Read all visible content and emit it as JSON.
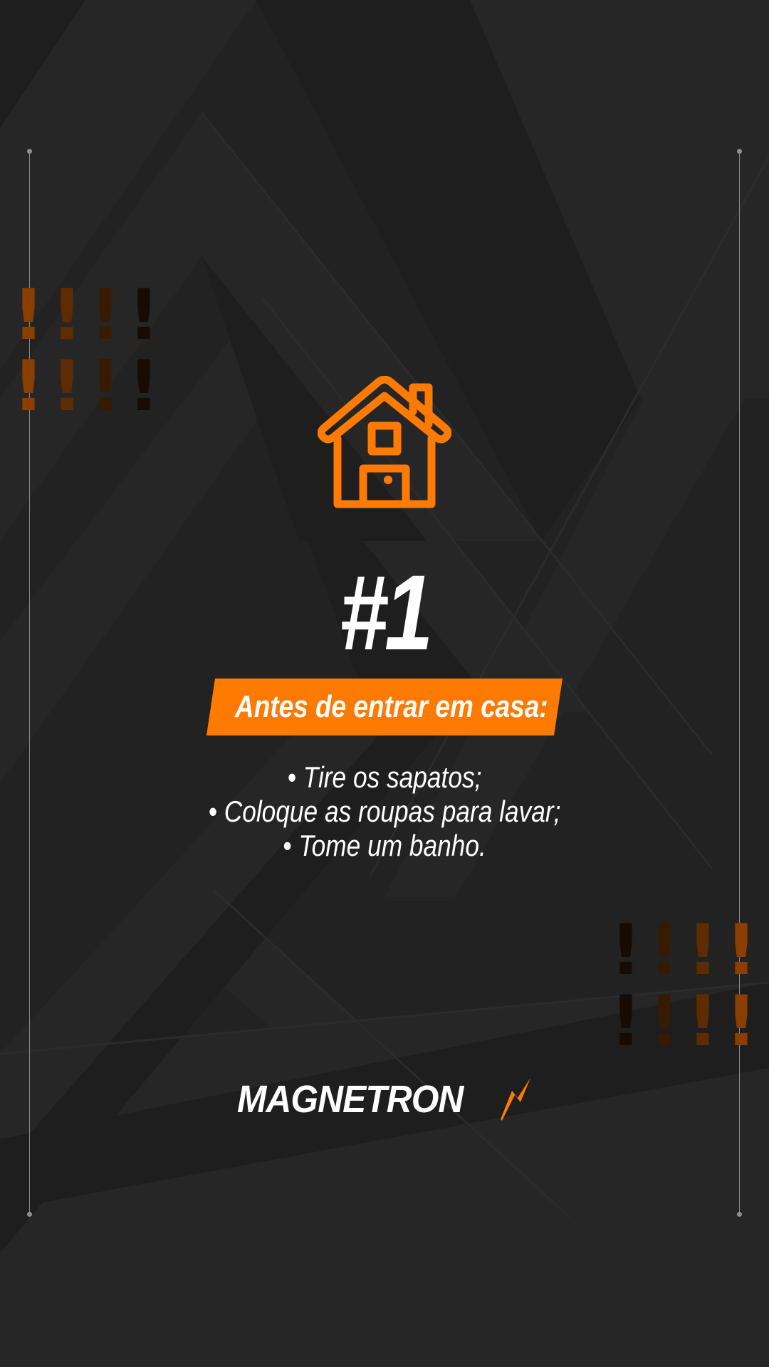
{
  "poster": {
    "number": "#1",
    "heading": "Antes de entrar em casa:",
    "tips": [
      "• Tire os sapatos;",
      "• Coloque as roupas para lavar;",
      "• Tome um banho."
    ],
    "brand": "MAGNETRON",
    "icons": {
      "main": "house-icon",
      "brand_mark": "lightning-bolt-icon",
      "decoration": "exclamation-marks"
    },
    "colors": {
      "background": "#222222",
      "accent": "#ff7a00",
      "text": "#ffffff"
    }
  }
}
